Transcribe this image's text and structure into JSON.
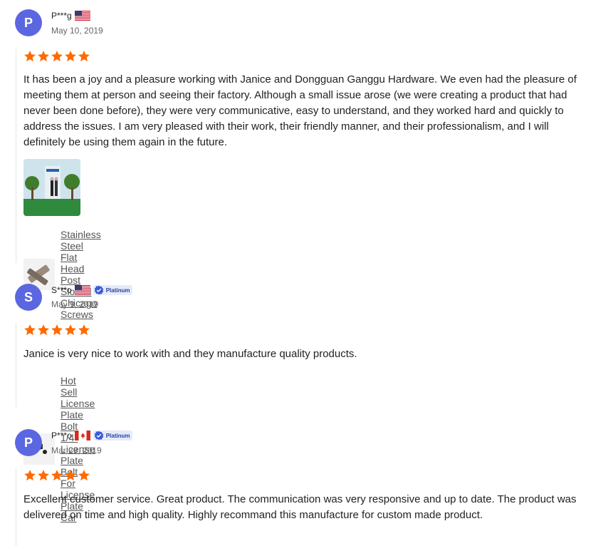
{
  "reviews": [
    {
      "initial": "P",
      "username": "P***g",
      "country": "US",
      "badge": "",
      "date": "May 10, 2019",
      "rating": 5,
      "text": "It has been a joy and a pleasure working with Janice and Dongguan Ganggu Hardware. We even had the pleasure of meeting them at person and seeing their factory. Although a small issue arose (we were creating a product that had never been done before), they were very communicative, easy to understand, and they worked hard and quickly to address the issues. I am very pleased with their work, their friendly manner, and their professionalism, and I will definitely be using them again in the future.",
      "product": "Stainless Steel Flat Head Post Slotted Chicago Screws"
    },
    {
      "initial": "S",
      "username": "S***o",
      "country": "US",
      "badge": "Platinum",
      "date": "May 9, 2019",
      "rating": 5,
      "text": "Janice is very nice to work with and they manufacture quality products.",
      "product": "Hot Sell License Plate Bolt 1/4\" License Plate Bolt For License Plate Car"
    },
    {
      "initial": "P",
      "username": "P***o",
      "country": "CA",
      "badge": "Platinum",
      "date": "Mar 29, 2019",
      "rating": 5,
      "text": "Excellent customer service. Great product. The communication was very responsive and up to date. The product was delivered on time and high quality. Highly recommand this manufacture for custom made product."
    }
  ],
  "colors": {
    "star": "#ff6a00",
    "avatar": "#5b67e0",
    "badge_bg": "#e6ebfb"
  }
}
